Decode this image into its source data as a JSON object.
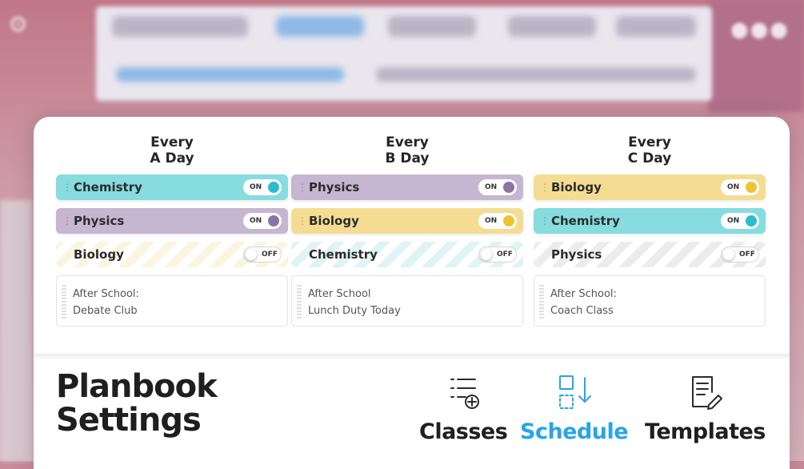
{
  "columns": [
    {
      "title_line1": "Every",
      "title_line2": "A Day",
      "classes": [
        {
          "name": "Chemistry",
          "state": "ON",
          "color": "#86dcdf",
          "knob": "#2cbcd0"
        },
        {
          "name": "Physics",
          "state": "ON",
          "color": "#c6b6d0",
          "knob": "#8d73a4"
        },
        {
          "name": "Biology",
          "state": "OFF"
        }
      ],
      "note_line1": "After School:",
      "note_line2": "Debate Club"
    },
    {
      "title_line1": "Every",
      "title_line2": "B Day",
      "classes": [
        {
          "name": "Physics",
          "state": "ON",
          "color": "#c6b6d0",
          "knob": "#8d73a4"
        },
        {
          "name": "Biology",
          "state": "ON",
          "color": "#f4dd93",
          "knob": "#f0c431"
        },
        {
          "name": "Chemistry",
          "state": "OFF"
        }
      ],
      "note_line1": "After School",
      "note_line2": "Lunch Duty Today"
    },
    {
      "title_line1": "Every",
      "title_line2": "C Day",
      "classes": [
        {
          "name": "Biology",
          "state": "ON",
          "color": "#f4dd93",
          "knob": "#f0c431"
        },
        {
          "name": "Chemistry",
          "state": "ON",
          "color": "#86dcdf",
          "knob": "#2cbcd0"
        },
        {
          "name": "Physics",
          "state": "OFF"
        }
      ],
      "note_line1": "After School:",
      "note_line2": "Coach Class"
    }
  ],
  "settings": {
    "title_line1": "Planbook",
    "title_line2": "Settings"
  },
  "nav": {
    "classes_label": "Classes",
    "schedule_label": "Schedule",
    "templates_label": "Templates",
    "active": "Schedule",
    "active_color": "#2aa3e8"
  }
}
